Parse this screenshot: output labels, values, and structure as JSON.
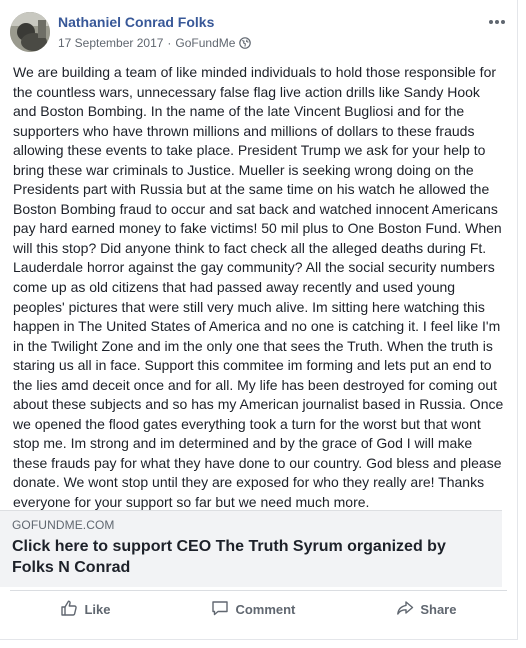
{
  "post": {
    "author": "Nathaniel Conrad Folks",
    "date": "17 September 2017",
    "separator": "·",
    "source": "GoFundMe",
    "privacy_icon": "globe-icon",
    "body": "We are building a team of like minded individuals to hold those responsible for the countless wars, unnecessary false flag live action drills like Sandy Hook and Boston Bombing. In the name of the late Vincent Bugliosi and for the supporters who have thrown millions and millions of dollars to these frauds allowing these events to take place. President Trump we ask for your help to bring these war criminals to Justice. Mueller is seeking wrong doing on the Presidents part with Russia but at the same time on his watch he allowed the Boston Bombing fraud to occur and sat back and watched innocent Americans pay hard earned money to fake victims! 50 mil plus to One Boston Fund. When will this stop? Did anyone think to fact check all the alleged deaths during Ft. Lauderdale horror against the gay community? All the social security numbers come up as old citizens that had passed away recently and used young peoples' pictures that were still very much alive. Im sitting here watching this happen in The United States of America and no one is catching it. I feel like I'm in the Twilight Zone and im the only one that sees the Truth. When the truth is staring us all in face. Support this commitee im forming and lets put an end to the lies amd deceit once and for all. My life has been destroyed for coming out about these subjects and so has my American journalist based in Russia. Once we opened the flood gates everything took a turn for the worst but that wont stop me. Im strong and im determined and by the grace of God I will make these frauds pay for what they have done to our country. God bless and please donate. We wont stop until they are exposed for who they really are! Thanks everyone for your support so far but we need much more."
  },
  "link_preview": {
    "domain": "GOFUNDME.COM",
    "title": "Click here to support CEO The Truth Syrum organized by Folks N Conrad"
  },
  "actions": {
    "like": "Like",
    "comment": "Comment",
    "share": "Share"
  },
  "colors": {
    "author_link": "#385898",
    "meta_text": "#606770",
    "link_card_bg": "#f2f3f5"
  }
}
